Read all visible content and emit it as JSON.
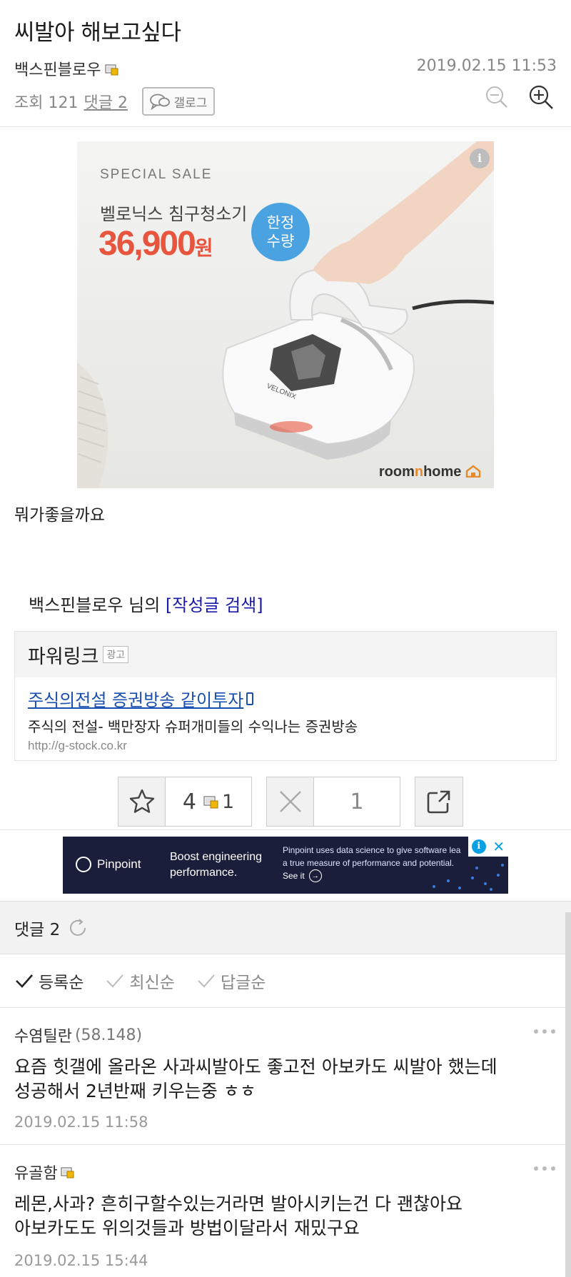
{
  "post": {
    "title": "씨발아 해보고싶다",
    "author": "백스핀블로우",
    "date": "2019.02.15 11:53",
    "views_label": "조회 121",
    "comments_label": "댓글 2",
    "gallog_label": "갤로그",
    "body": "뭐가좋을까요"
  },
  "ad": {
    "info_label": "i",
    "special": "SPECIAL SALE",
    "product": "벨로닉스 침구청소기",
    "price": "36,900",
    "price_unit": "원",
    "badge_line1": "한정",
    "badge_line2": "수량",
    "brand_a": "room",
    "brand_b": "n",
    "brand_c": "home",
    "device_label": "VELONIX"
  },
  "author_search": {
    "prefix": "백스핀블로우 님의 ",
    "link": "[작성글 검색]"
  },
  "powerlink": {
    "title": "파워링크",
    "ad_tag": "광고",
    "link_text": "주식의전설 증권방송 같이투자",
    "description": "주식의 전설- 백만장자 슈퍼개미들의 수익나는 증권방송",
    "url": "http://g-stock.co.kr"
  },
  "votes": {
    "up_count": "4",
    "fixed_count": "1",
    "down_count": "1"
  },
  "pinpoint_ad": {
    "brand": "Pinpoint",
    "headline_1": "Boost engineering",
    "headline_2": "performance.",
    "desc_1": "Pinpoint uses data science to give software lea",
    "desc_2": "a true measure of performance and potential.",
    "see_it": "See it",
    "info_label": "i",
    "close_label": "✕"
  },
  "comments": {
    "header": "댓글 2",
    "sort_options": [
      "등록순",
      "최신순",
      "답글순"
    ],
    "items": [
      {
        "author": "수염틸란",
        "score": "(58.148)",
        "text_line1": "요즘 힛갤에 올라온 사과씨발아도 좋고전 아보카도 씨발아 했는데",
        "text_line2": "성공해서 2년반째 키우는중 ㅎㅎ",
        "date": "2019.02.15 11:58"
      },
      {
        "author": "유골함",
        "text_line1": "레몬,사과? 흔히구할수있는거라면 발아시키는건 다 괜찮아요",
        "text_line2": "아보카도도 위의것들과 방법이달라서 재밌구요",
        "date": "2019.02.15 15:44"
      }
    ]
  },
  "colors": {
    "link_blue": "#1a4fb0",
    "price_red": "#e8553e",
    "badge_blue": "#4aa3e0",
    "pinpoint_bg": "#1a1e3a"
  }
}
